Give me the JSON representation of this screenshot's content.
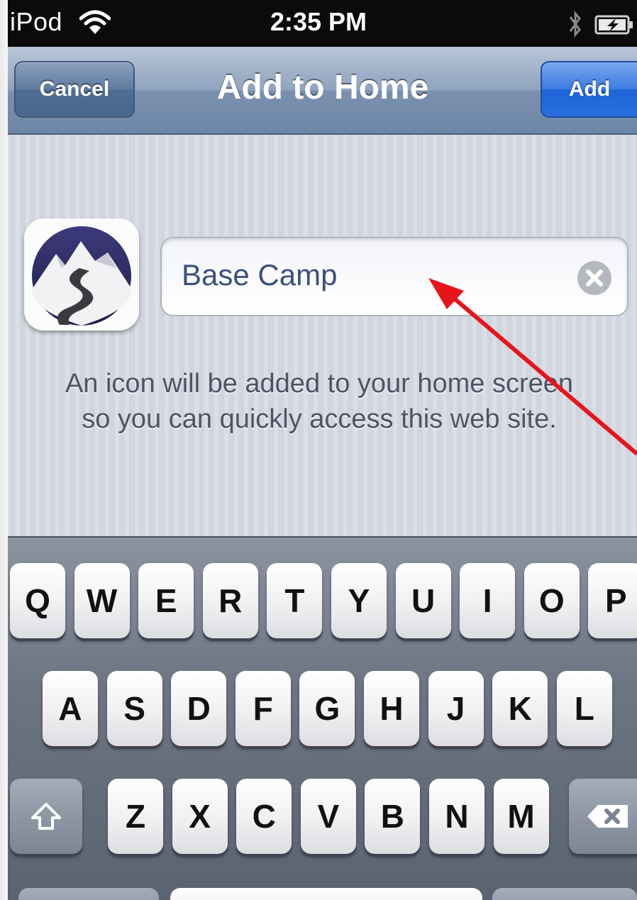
{
  "status_bar": {
    "carrier": "iPod",
    "time": "2:35 PM",
    "wifi_icon": "wifi-icon",
    "bluetooth_icon": "bluetooth-icon",
    "battery_icon": "battery-charging-icon"
  },
  "nav_bar": {
    "title": "Add to Home",
    "cancel_label": "Cancel",
    "add_label": "Add"
  },
  "content": {
    "app_icon": "base-camp-mountain-icon",
    "name_field_value": "Base Camp",
    "clear_icon": "clear-circle-icon",
    "hint_line_1": "An icon will be added to your home screen",
    "hint_line_2": "so you can quickly access this web site."
  },
  "annotation": {
    "arrow_color": "#e8141b"
  },
  "keyboard": {
    "row1": [
      "Q",
      "W",
      "E",
      "R",
      "T",
      "Y",
      "U",
      "I",
      "O",
      "P"
    ],
    "row2": [
      "A",
      "S",
      "D",
      "F",
      "G",
      "H",
      "J",
      "K",
      "L"
    ],
    "row3": [
      "Z",
      "X",
      "C",
      "V",
      "B",
      "N",
      "M"
    ],
    "shift_icon": "shift-arrow-icon",
    "delete_icon": "backspace-icon"
  },
  "colors": {
    "nav_blue": "#6d86a6",
    "add_blue": "#2a6fe0",
    "text_field_value": "#3b5179"
  }
}
